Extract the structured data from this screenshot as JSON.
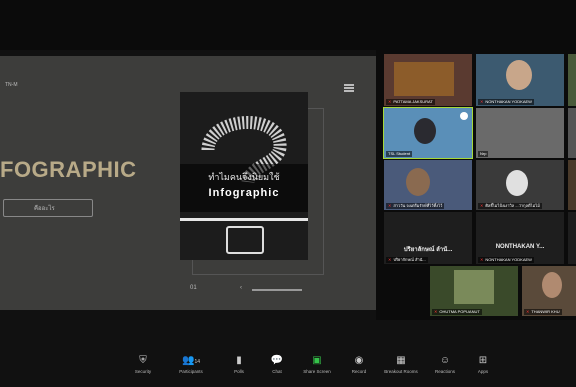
{
  "share": {
    "name_label": "TN-M",
    "big_title": "FOGRAPHIC",
    "pill_label": "คืออะไร",
    "poster_thai": "ทำไมคนจึงนิยมใช้",
    "poster_en": "Infographic",
    "pager_left": "01"
  },
  "gallery": {
    "tiles": [
      {
        "label": "PATTAMA JAKSURAT"
      },
      {
        "label": "NONTHAKAN YODKAEW"
      },
      {
        "label": "TSL Student"
      },
      {
        "label": "Nrp"
      },
      {
        "label": "สาววัน จงเตรีมรักษ์ที่ไว้ทิ้งไว้"
      },
      {
        "label": "ศิลธิ์ไม่ไป้งเงาวิล ...ว่ากุลดีไม่ไม้"
      },
      {
        "label": "ปริยากักษณ์ สำนั...",
        "center": "ปริยาลักษณ์ ลำนั..."
      },
      {
        "label": "NONTHAKAN YODKAEW",
        "center": "NONTHAKAN Y..."
      },
      {
        "label": "OHUTMA POPUANUT"
      },
      {
        "label": "THANWIR KHU"
      }
    ]
  },
  "toolbar": {
    "security": "Security",
    "participants": "Participants",
    "participants_count": "14",
    "polls": "Polls",
    "chat": "Chat",
    "share_screen": "Share Screen",
    "record": "Record",
    "breakout": "Breakout Rooms",
    "reactions": "Reactions",
    "apps": "Apps"
  },
  "colors": {
    "active_border": "#a6d93a",
    "share_green": "#35c24a",
    "mic_off": "#e33333",
    "title_gold": "#b8aa88"
  }
}
